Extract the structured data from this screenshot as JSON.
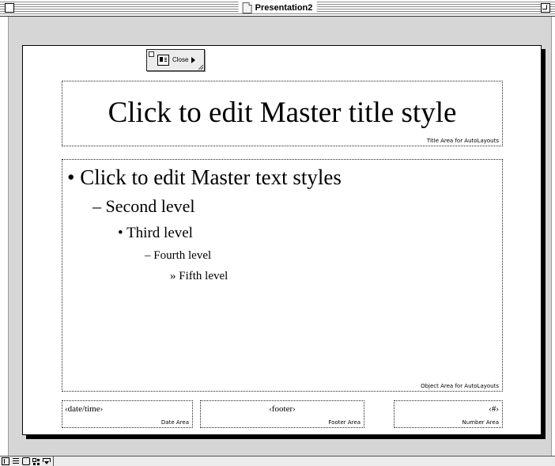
{
  "window": {
    "title": "Presentation2"
  },
  "palette": {
    "close_label": "Close"
  },
  "slide": {
    "title_placeholder": {
      "text": "Click to edit Master title style",
      "area_label": "Title Area for AutoLayouts"
    },
    "body_placeholder": {
      "levels": [
        {
          "bullet": "•",
          "text": "Click to edit Master text styles"
        },
        {
          "bullet": "–",
          "text": "Second level"
        },
        {
          "bullet": "•",
          "text": "Third level"
        },
        {
          "bullet": "–",
          "text": "Fourth level"
        },
        {
          "bullet": "»",
          "text": "Fifth level"
        }
      ],
      "area_label": "Object Area for AutoLayouts"
    },
    "date_placeholder": {
      "field": "‹date/time›",
      "area_label": "Date Area"
    },
    "footer_placeholder": {
      "field": "‹footer›",
      "area_label": "Footer Area"
    },
    "number_placeholder": {
      "field": "‹#›",
      "area_label": "Number Area"
    }
  },
  "view_buttons": [
    {
      "icon": "normal-view-icon"
    },
    {
      "icon": "outline-view-icon"
    },
    {
      "icon": "slide-view-icon"
    },
    {
      "icon": "slide-sorter-view-icon"
    },
    {
      "icon": "slide-show-icon"
    }
  ]
}
